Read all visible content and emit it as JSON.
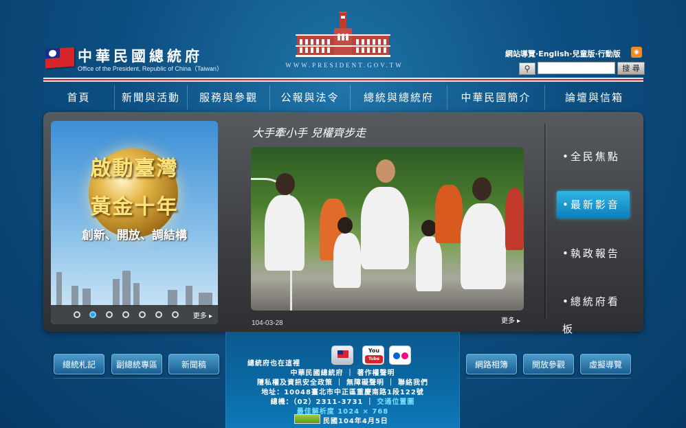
{
  "header": {
    "title_zh": "中華民國總統府",
    "title_en": "Office of the President, Republic of China（Taiwan）",
    "url": "WWW.PRESIDENT.GOV.TW",
    "toplinks": [
      "網站導覽",
      "English",
      "兒童版",
      "行動版"
    ],
    "search": {
      "value": "",
      "button": "搜 尋"
    }
  },
  "nav": [
    "首頁",
    "新聞與活動",
    "服務與參觀",
    "公報與法令",
    "總統與總統府",
    "中華民國簡介",
    "論壇與信箱"
  ],
  "promo": {
    "line1": "啟動臺灣",
    "line2": "黃金十年",
    "line3": "創新、開放、調結構",
    "more": "更多 ▸"
  },
  "news": {
    "title": "大手牽小手 兒權齊步走",
    "date": "104-03-28",
    "more": "更多 ▸"
  },
  "side_menu": [
    "•全民焦點",
    "•最新影音",
    "•執政報告",
    "•總統府看板"
  ],
  "footer": {
    "left_buttons": [
      "總統札記",
      "副總統專區",
      "新聞稿"
    ],
    "right_buttons": [
      "網路相簿",
      "開放參觀",
      "虛擬導覽"
    ],
    "lines": {
      "l1": "總統府也在這裡",
      "l2": "中華民國總統府 ｜ 著作權聲明",
      "l3": "隱私權及資訊安全政策 ｜ 無障礙聲明 ｜ 聯絡我們",
      "l4": "地址：10048臺北市中正區重慶南路1段122號",
      "l5a": "總機：（02）2311-3731 ｜ ",
      "l5b": "交通位置圖",
      "l6": "最佳解析度 1024 × 768",
      "l7": "民國104年4月5日"
    },
    "youtube": "You Tube"
  }
}
